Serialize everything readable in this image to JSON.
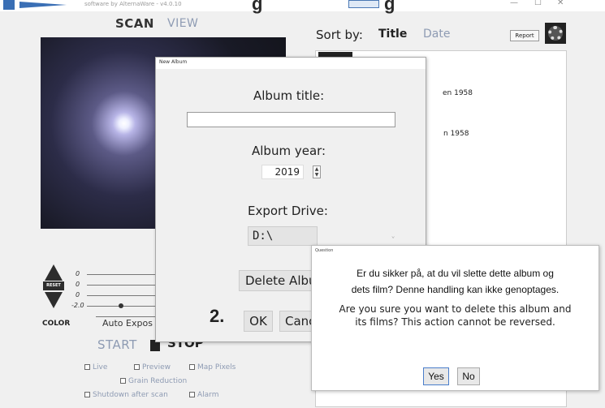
{
  "titlebar": {
    "subtitle": "software by AlternaWare - v4.0.10",
    "brand_fragment": "g",
    "brand_fragment_2": "g",
    "minimize": "—",
    "maximize": "☐",
    "close": "✕"
  },
  "left_pane": {
    "mode_scan": "SCAN",
    "mode_view": "VIEW",
    "slider_ticks": [
      "0",
      "0",
      "0",
      "-2.0"
    ],
    "reset_label": "RESET",
    "color_label": "COLOR",
    "auto_exposure_label": "Auto Expos",
    "start_label": "START",
    "stop_label": "STOP",
    "options": {
      "live": "Live",
      "preview": "Preview",
      "map_pixels": "Map Pixels",
      "grain_reduction": "Grain Reduction",
      "shutdown_after_scan": "Shutdown after scan",
      "alarm": "Alarm"
    }
  },
  "right_pane": {
    "sort_label": "Sort by:",
    "sort_title": "Title",
    "sort_date": "Date",
    "report_label": "Report",
    "albums": [
      "en 1958",
      "n 1958"
    ]
  },
  "new_album_dialog": {
    "title": "New Album",
    "album_title_label": "Album title:",
    "album_title_value": "",
    "album_year_label": "Album year:",
    "album_year_value": "2019",
    "export_drive_label": "Export Drive:",
    "export_drive_value": "D:\\",
    "delete_album_label": "Delete Album",
    "step_label": "2.",
    "ok_label": "OK",
    "cancel_label": "Cancel"
  },
  "question_dialog": {
    "title": "Question",
    "danish_line1": "Er du sikker på, at du vil slette dette album og",
    "danish_line2": "dets film? Denne handling kan ikke genoptages.",
    "english_line1": "Are you sure you want to delete this album and",
    "english_line2": "its films? This action cannot be reversed.",
    "yes_label": "Yes",
    "no_label": "No"
  },
  "colors": {
    "accent_muted": "#8e9bb3",
    "dialog_focus": "#4a7ecb",
    "window_bg": "#f0f0f0"
  }
}
